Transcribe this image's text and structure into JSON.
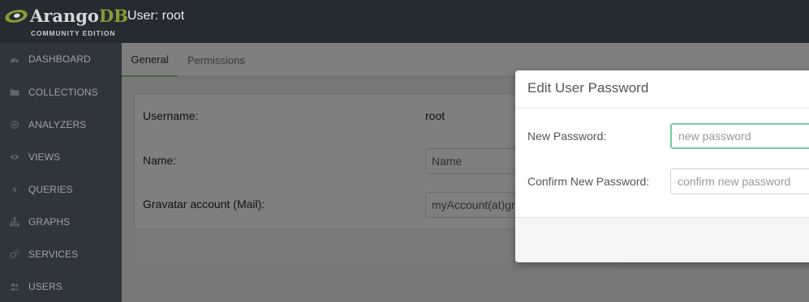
{
  "app": {
    "brand_main": "Arango",
    "brand_accent": "DB",
    "edition": "COMMUNITY EDITION",
    "page_title": "User: root"
  },
  "sidebar": {
    "items": [
      {
        "label": "DASHBOARD",
        "icon": "dashboard-icon"
      },
      {
        "label": "COLLECTIONS",
        "icon": "folder-icon"
      },
      {
        "label": "ANALYZERS",
        "icon": "cog-icon"
      },
      {
        "label": "VIEWS",
        "icon": "eye-icon"
      },
      {
        "label": "QUERIES",
        "icon": "bolt-icon"
      },
      {
        "label": "GRAPHS",
        "icon": "sitemap-icon"
      },
      {
        "label": "SERVICES",
        "icon": "cogs-icon"
      },
      {
        "label": "USERS",
        "icon": "users-icon"
      }
    ]
  },
  "tabs": {
    "general": "General",
    "permissions": "Permissions",
    "active": "General"
  },
  "form": {
    "username_label": "Username:",
    "username_value": "root",
    "name_label": "Name:",
    "name_placeholder": "Name",
    "gravatar_label": "Gravatar account (Mail):",
    "gravatar_placeholder": "myAccount(at)gmail.com"
  },
  "modal": {
    "title": "Edit User Password",
    "new_password_label": "New Password:",
    "new_password_placeholder": "new password",
    "confirm_password_label": "Confirm New Password:",
    "confirm_password_placeholder": "confirm new password"
  },
  "colors": {
    "brand_green": "#8a9a35",
    "focus_border": "#77cb99",
    "tab_underline": "#466b35",
    "sidebar_bg": "#2e353b",
    "header_bg": "#242b31"
  }
}
